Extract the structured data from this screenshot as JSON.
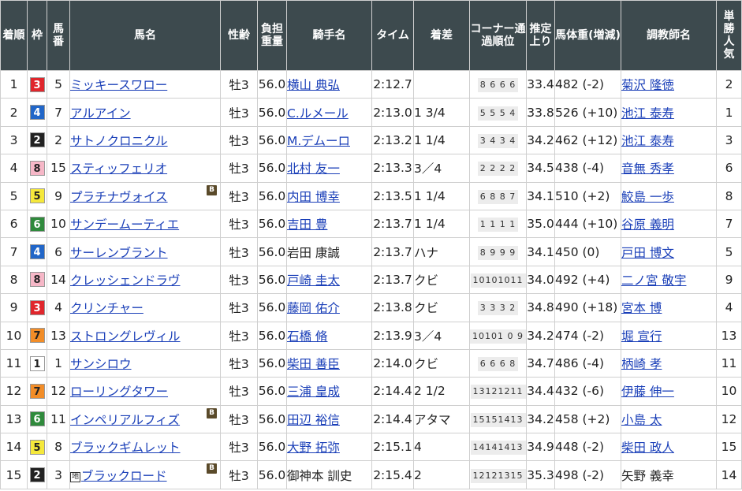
{
  "headers": {
    "rank": "着順",
    "frame": "枠",
    "num": "馬番",
    "horse": "馬名",
    "sexage": "性齢",
    "weight": "負担重量",
    "jockey": "騎手名",
    "time": "タイム",
    "margin": "着差",
    "corner": "コーナー通過順位",
    "last3f": "推定上り",
    "bodyweight": "馬体重(増減)",
    "trainer": "調教師名",
    "popularity": "単勝人気"
  },
  "frame_colors": {
    "1": {
      "bg": "#ffffff",
      "fg": "#222222"
    },
    "2": {
      "bg": "#222222",
      "fg": "#ffffff"
    },
    "3": {
      "bg": "#e0262c",
      "fg": "#ffffff"
    },
    "4": {
      "bg": "#2166c8",
      "fg": "#ffffff"
    },
    "5": {
      "bg": "#f5e83b",
      "fg": "#222222"
    },
    "6": {
      "bg": "#2f8a3c",
      "fg": "#ffffff"
    },
    "7": {
      "bg": "#f28d28",
      "fg": "#222222"
    },
    "8": {
      "bg": "#f6b7c7",
      "fg": "#222222"
    }
  },
  "rows": [
    {
      "rank": "1",
      "frame": "3",
      "num": "5",
      "horse": "ミッキースワロー",
      "blinker": false,
      "chihou": false,
      "sexage": "牡3",
      "weight": "56.0",
      "jockey": "横山 典弘",
      "jockey_link": true,
      "time": "2:12.7",
      "margin": "",
      "corner": "8 6 6 6",
      "last3f": "33.4",
      "bodyweight": "482 (-2)",
      "trainer": "菊沢 隆徳",
      "trainer_link": true,
      "pop": "2"
    },
    {
      "rank": "2",
      "frame": "4",
      "num": "7",
      "horse": "アルアイン",
      "blinker": false,
      "chihou": false,
      "sexage": "牡3",
      "weight": "56.0",
      "jockey": "C.ルメール",
      "jockey_link": true,
      "time": "2:13.0",
      "margin": "1 3/4",
      "corner": "5 5 5 4",
      "last3f": "33.8",
      "bodyweight": "526 (+10)",
      "trainer": "池江 泰寿",
      "trainer_link": true,
      "pop": "1"
    },
    {
      "rank": "3",
      "frame": "2",
      "num": "2",
      "horse": "サトノクロニクル",
      "blinker": false,
      "chihou": false,
      "sexage": "牡3",
      "weight": "56.0",
      "jockey": "M.デムーロ",
      "jockey_link": true,
      "time": "2:13.2",
      "margin": "1 1/4",
      "corner": "3 4 3 4",
      "last3f": "34.2",
      "bodyweight": "462 (+12)",
      "trainer": "池江 泰寿",
      "trainer_link": true,
      "pop": "3"
    },
    {
      "rank": "4",
      "frame": "8",
      "num": "15",
      "horse": "スティッフェリオ",
      "blinker": false,
      "chihou": false,
      "sexage": "牡3",
      "weight": "56.0",
      "jockey": "北村 友一",
      "jockey_link": true,
      "time": "2:13.3",
      "margin": "3／4",
      "corner": "2 2 2 2",
      "last3f": "34.5",
      "bodyweight": "438 (-4)",
      "trainer": "音無 秀孝",
      "trainer_link": true,
      "pop": "6"
    },
    {
      "rank": "5",
      "frame": "5",
      "num": "9",
      "horse": "プラチナヴォイス",
      "blinker": true,
      "chihou": false,
      "sexage": "牡3",
      "weight": "56.0",
      "jockey": "内田 博幸",
      "jockey_link": true,
      "time": "2:13.5",
      "margin": "1 1/4",
      "corner": "6 8 8 7",
      "last3f": "34.1",
      "bodyweight": "510 (+2)",
      "trainer": "鮫島 一歩",
      "trainer_link": true,
      "pop": "8"
    },
    {
      "rank": "6",
      "frame": "6",
      "num": "10",
      "horse": "サンデームーティエ",
      "blinker": false,
      "chihou": false,
      "sexage": "牡3",
      "weight": "56.0",
      "jockey": "吉田 豊",
      "jockey_link": true,
      "time": "2:13.7",
      "margin": "1 1/4",
      "corner": "1 1 1 1",
      "last3f": "35.0",
      "bodyweight": "444 (+10)",
      "trainer": "谷原 義明",
      "trainer_link": true,
      "pop": "7"
    },
    {
      "rank": "7",
      "frame": "4",
      "num": "6",
      "horse": "サーレンブラント",
      "blinker": false,
      "chihou": false,
      "sexage": "牡3",
      "weight": "56.0",
      "jockey": "岩田 康誠",
      "jockey_link": false,
      "time": "2:13.7",
      "margin": "ハナ",
      "corner": "8 9 9 9",
      "last3f": "34.1",
      "bodyweight": "450 (0)",
      "trainer": "戸田 博文",
      "trainer_link": true,
      "pop": "5"
    },
    {
      "rank": "8",
      "frame": "8",
      "num": "14",
      "horse": "クレッシェンドラヴ",
      "blinker": false,
      "chihou": false,
      "sexage": "牡3",
      "weight": "56.0",
      "jockey": "戸崎 圭太",
      "jockey_link": true,
      "time": "2:13.7",
      "margin": "クビ",
      "corner": "10101011",
      "last3f": "34.0",
      "bodyweight": "492 (+4)",
      "trainer": "二ノ宮 敬宇",
      "trainer_link": true,
      "pop": "9"
    },
    {
      "rank": "9",
      "frame": "3",
      "num": "4",
      "horse": "クリンチャー",
      "blinker": false,
      "chihou": false,
      "sexage": "牡3",
      "weight": "56.0",
      "jockey": "藤岡 佑介",
      "jockey_link": true,
      "time": "2:13.8",
      "margin": "クビ",
      "corner": "3 3 3 2",
      "last3f": "34.8",
      "bodyweight": "490 (+18)",
      "trainer": "宮本 博",
      "trainer_link": true,
      "pop": "4"
    },
    {
      "rank": "10",
      "frame": "7",
      "num": "13",
      "horse": "ストロングレヴィル",
      "blinker": false,
      "chihou": false,
      "sexage": "牡3",
      "weight": "56.0",
      "jockey": "石橋 脩",
      "jockey_link": true,
      "time": "2:13.9",
      "margin": "3／4",
      "corner": "10101 0 9",
      "last3f": "34.2",
      "bodyweight": "474 (-2)",
      "trainer": "堀 宣行",
      "trainer_link": true,
      "pop": "13"
    },
    {
      "rank": "11",
      "frame": "1",
      "num": "1",
      "horse": "サンシロウ",
      "blinker": false,
      "chihou": false,
      "sexage": "牡3",
      "weight": "56.0",
      "jockey": "柴田 善臣",
      "jockey_link": true,
      "time": "2:14.0",
      "margin": "クビ",
      "corner": "6 6 6 8",
      "last3f": "34.7",
      "bodyweight": "486 (-4)",
      "trainer": "柄崎 孝",
      "trainer_link": true,
      "pop": "11"
    },
    {
      "rank": "12",
      "frame": "7",
      "num": "12",
      "horse": "ローリングタワー",
      "blinker": false,
      "chihou": false,
      "sexage": "牡3",
      "weight": "56.0",
      "jockey": "三浦 皇成",
      "jockey_link": true,
      "time": "2:14.4",
      "margin": "2 1/2",
      "corner": "13121211",
      "last3f": "34.4",
      "bodyweight": "432 (-6)",
      "trainer": "伊藤 伸一",
      "trainer_link": true,
      "pop": "10"
    },
    {
      "rank": "13",
      "frame": "6",
      "num": "11",
      "horse": "インペリアルフィズ",
      "blinker": true,
      "chihou": false,
      "sexage": "牡3",
      "weight": "56.0",
      "jockey": "田辺 裕信",
      "jockey_link": true,
      "time": "2:14.4",
      "margin": "アタマ",
      "corner": "15151413",
      "last3f": "34.2",
      "bodyweight": "458 (+2)",
      "trainer": "小島 太",
      "trainer_link": true,
      "pop": "12"
    },
    {
      "rank": "14",
      "frame": "5",
      "num": "8",
      "horse": "ブラックギムレット",
      "blinker": false,
      "chihou": false,
      "sexage": "牡3",
      "weight": "56.0",
      "jockey": "大野 拓弥",
      "jockey_link": true,
      "time": "2:15.1",
      "margin": "4",
      "corner": "14141413",
      "last3f": "34.9",
      "bodyweight": "448 (-2)",
      "trainer": "柴田 政人",
      "trainer_link": true,
      "pop": "15"
    },
    {
      "rank": "15",
      "frame": "2",
      "num": "3",
      "horse": "ブラックロード",
      "blinker": true,
      "chihou": true,
      "sexage": "牡3",
      "weight": "56.0",
      "jockey": "御神本 訓史",
      "jockey_link": false,
      "time": "2:15.4",
      "margin": "2",
      "corner": "12121315",
      "last3f": "35.3",
      "bodyweight": "498 (-2)",
      "trainer": "矢野 義幸",
      "trainer_link": false,
      "pop": "14"
    }
  ],
  "marks": {
    "blinker": "B",
    "chihou": "地"
  }
}
